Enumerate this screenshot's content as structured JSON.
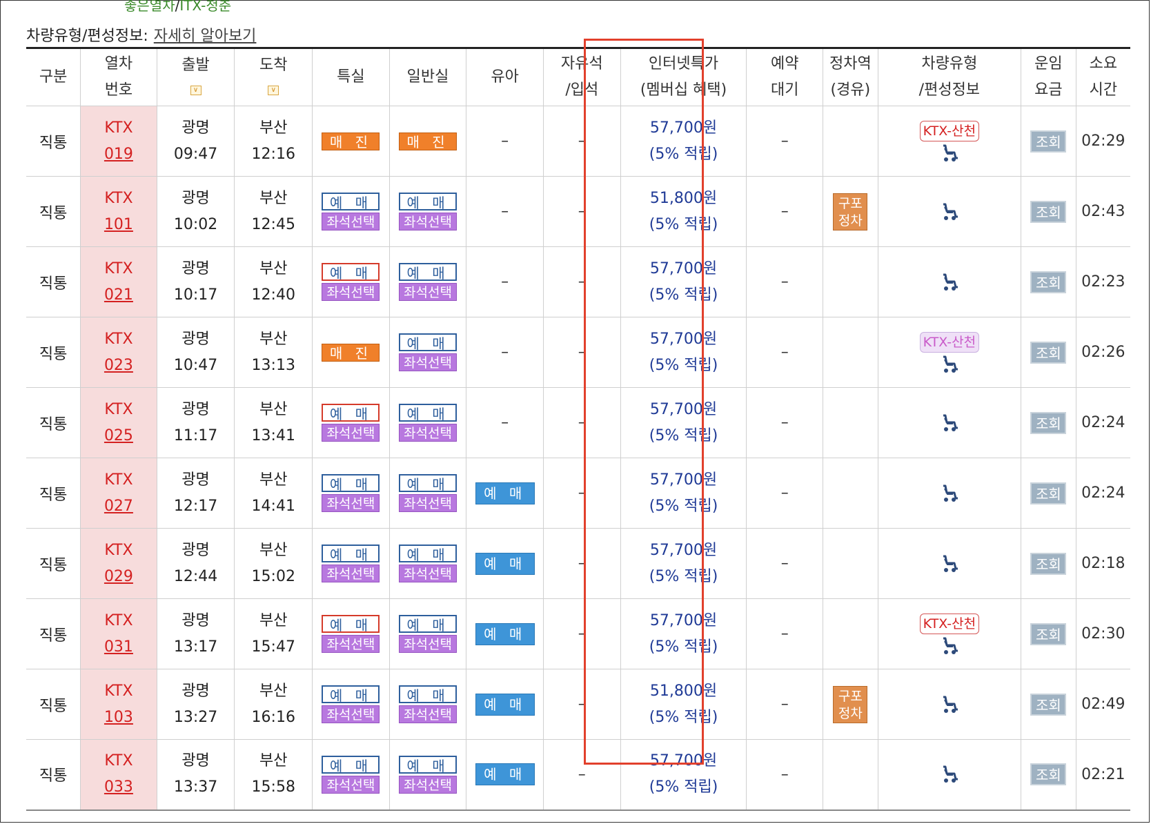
{
  "top_legend": {
    "green_text": "좋은열차",
    "separator": "/",
    "rest_text": "ITX-청춘"
  },
  "info": {
    "label": "차량유형/편성정보:",
    "link": "자세히 알아보기"
  },
  "headers": {
    "category": "구분",
    "train_no": [
      "열차",
      "번호"
    ],
    "departure": "출발",
    "arrival": "도착",
    "special": "특실",
    "general": "일반실",
    "infant": "유아",
    "free_seat": [
      "자유석",
      "/입석"
    ],
    "internet": [
      "인터넷특가",
      "(멤버십 혜택)"
    ],
    "waitlist": [
      "예약",
      "대기"
    ],
    "stops": [
      "정차역",
      "(경유)"
    ],
    "vehicle": [
      "차량유형",
      "/편성정보"
    ],
    "fare": [
      "운임",
      "요금"
    ],
    "duration": [
      "소요",
      "시간"
    ]
  },
  "labels": {
    "sold_out": "매 진",
    "book": "예 매",
    "seat_select": "좌석선택",
    "dash": "–",
    "points": "(5% 적립)",
    "inquiry": "조회",
    "stop_badge": [
      "구포",
      "정차"
    ],
    "ktx_sancheon": "KTX-산천",
    "sort_icon": "∨"
  },
  "rows": [
    {
      "cat": "직통",
      "ktx": "KTX",
      "num": "019",
      "dep_st": "광명",
      "dep": "09:47",
      "arr_st": "부산",
      "arr": "12:16",
      "special": "sold",
      "general": "sold",
      "infant": false,
      "price": "57,700원",
      "stop": false,
      "vtype": "normal",
      "dur": "02:29"
    },
    {
      "cat": "직통",
      "ktx": "KTX",
      "num": "101",
      "dep_st": "광명",
      "dep": "10:02",
      "arr_st": "부산",
      "arr": "12:45",
      "special": "book",
      "general": "book",
      "infant": false,
      "price": "51,800원",
      "stop": true,
      "vtype": "none",
      "dur": "02:43"
    },
    {
      "cat": "직통",
      "ktx": "KTX",
      "num": "021",
      "dep_st": "광명",
      "dep": "10:17",
      "arr_st": "부산",
      "arr": "12:40",
      "special": "book-red",
      "general": "book",
      "infant": false,
      "price": "57,700원",
      "stop": false,
      "vtype": "none",
      "dur": "02:23"
    },
    {
      "cat": "직통",
      "ktx": "KTX",
      "num": "023",
      "dep_st": "광명",
      "dep": "10:47",
      "arr_st": "부산",
      "arr": "13:13",
      "special": "sold",
      "general": "book",
      "infant": false,
      "price": "57,700원",
      "stop": false,
      "vtype": "pale",
      "dur": "02:26"
    },
    {
      "cat": "직통",
      "ktx": "KTX",
      "num": "025",
      "dep_st": "광명",
      "dep": "11:17",
      "arr_st": "부산",
      "arr": "13:41",
      "special": "book-red",
      "general": "book",
      "infant": false,
      "price": "57,700원",
      "stop": false,
      "vtype": "none",
      "dur": "02:24"
    },
    {
      "cat": "직통",
      "ktx": "KTX",
      "num": "027",
      "dep_st": "광명",
      "dep": "12:17",
      "arr_st": "부산",
      "arr": "14:41",
      "special": "book",
      "general": "book",
      "infant": true,
      "price": "57,700원",
      "stop": false,
      "vtype": "none",
      "dur": "02:24"
    },
    {
      "cat": "직통",
      "ktx": "KTX",
      "num": "029",
      "dep_st": "광명",
      "dep": "12:44",
      "arr_st": "부산",
      "arr": "15:02",
      "special": "book",
      "general": "book",
      "infant": true,
      "price": "57,700원",
      "stop": false,
      "vtype": "none",
      "dur": "02:18"
    },
    {
      "cat": "직통",
      "ktx": "KTX",
      "num": "031",
      "dep_st": "광명",
      "dep": "13:17",
      "arr_st": "부산",
      "arr": "15:47",
      "special": "book-red",
      "general": "book",
      "infant": true,
      "price": "57,700원",
      "stop": false,
      "vtype": "normal",
      "dur": "02:30"
    },
    {
      "cat": "직통",
      "ktx": "KTX",
      "num": "103",
      "dep_st": "광명",
      "dep": "13:27",
      "arr_st": "부산",
      "arr": "16:16",
      "special": "book",
      "general": "book",
      "infant": true,
      "price": "51,800원",
      "stop": true,
      "vtype": "none",
      "dur": "02:49"
    },
    {
      "cat": "직통",
      "ktx": "KTX",
      "num": "033",
      "dep_st": "광명",
      "dep": "13:37",
      "arr_st": "부산",
      "arr": "15:58",
      "special": "book",
      "general": "book",
      "infant": true,
      "price": "57,700원",
      "stop": false,
      "vtype": "none",
      "dur": "02:21"
    }
  ]
}
